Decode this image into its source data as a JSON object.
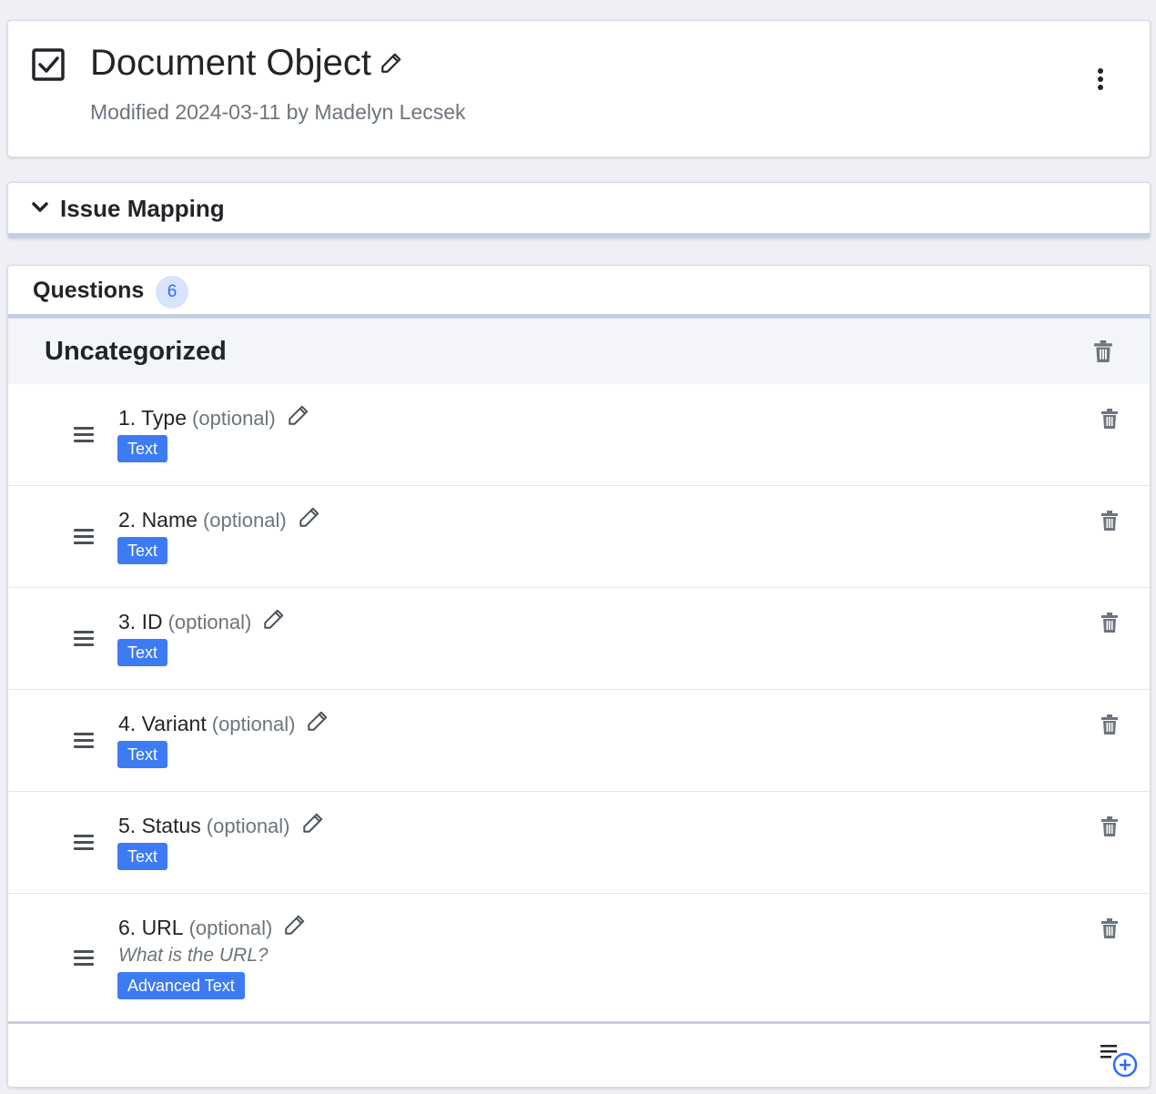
{
  "header": {
    "title": "Document Object",
    "modified": "Modified 2024-03-11 by Madelyn Lecsek",
    "icons": [
      "checkbox-icon",
      "pencil-icon",
      "kebab-menu-icon"
    ]
  },
  "issue_mapping": {
    "title": "Issue Mapping",
    "icon": "chevron-down-icon"
  },
  "questions": {
    "title": "Questions",
    "count": "6",
    "category": "Uncategorized",
    "items": [
      {
        "label": "1. Type",
        "optional": "(optional)",
        "badge": "Text",
        "description": ""
      },
      {
        "label": "2. Name",
        "optional": "(optional)",
        "badge": "Text",
        "description": ""
      },
      {
        "label": "3. ID",
        "optional": "(optional)",
        "badge": "Text",
        "description": ""
      },
      {
        "label": "4. Variant",
        "optional": "(optional)",
        "badge": "Text",
        "description": ""
      },
      {
        "label": "5. Status",
        "optional": "(optional)",
        "badge": "Text",
        "description": ""
      },
      {
        "label": "6. URL",
        "optional": "(optional)",
        "badge": "Advanced Text",
        "description": "What is the URL?"
      }
    ]
  },
  "colors": {
    "accent": "#3d7bf5",
    "count_badge_bg": "#d8e4ff",
    "count_badge_text": "#2f6bff",
    "muted_text": "#6c757d",
    "page_bg": "#eef0f6"
  }
}
